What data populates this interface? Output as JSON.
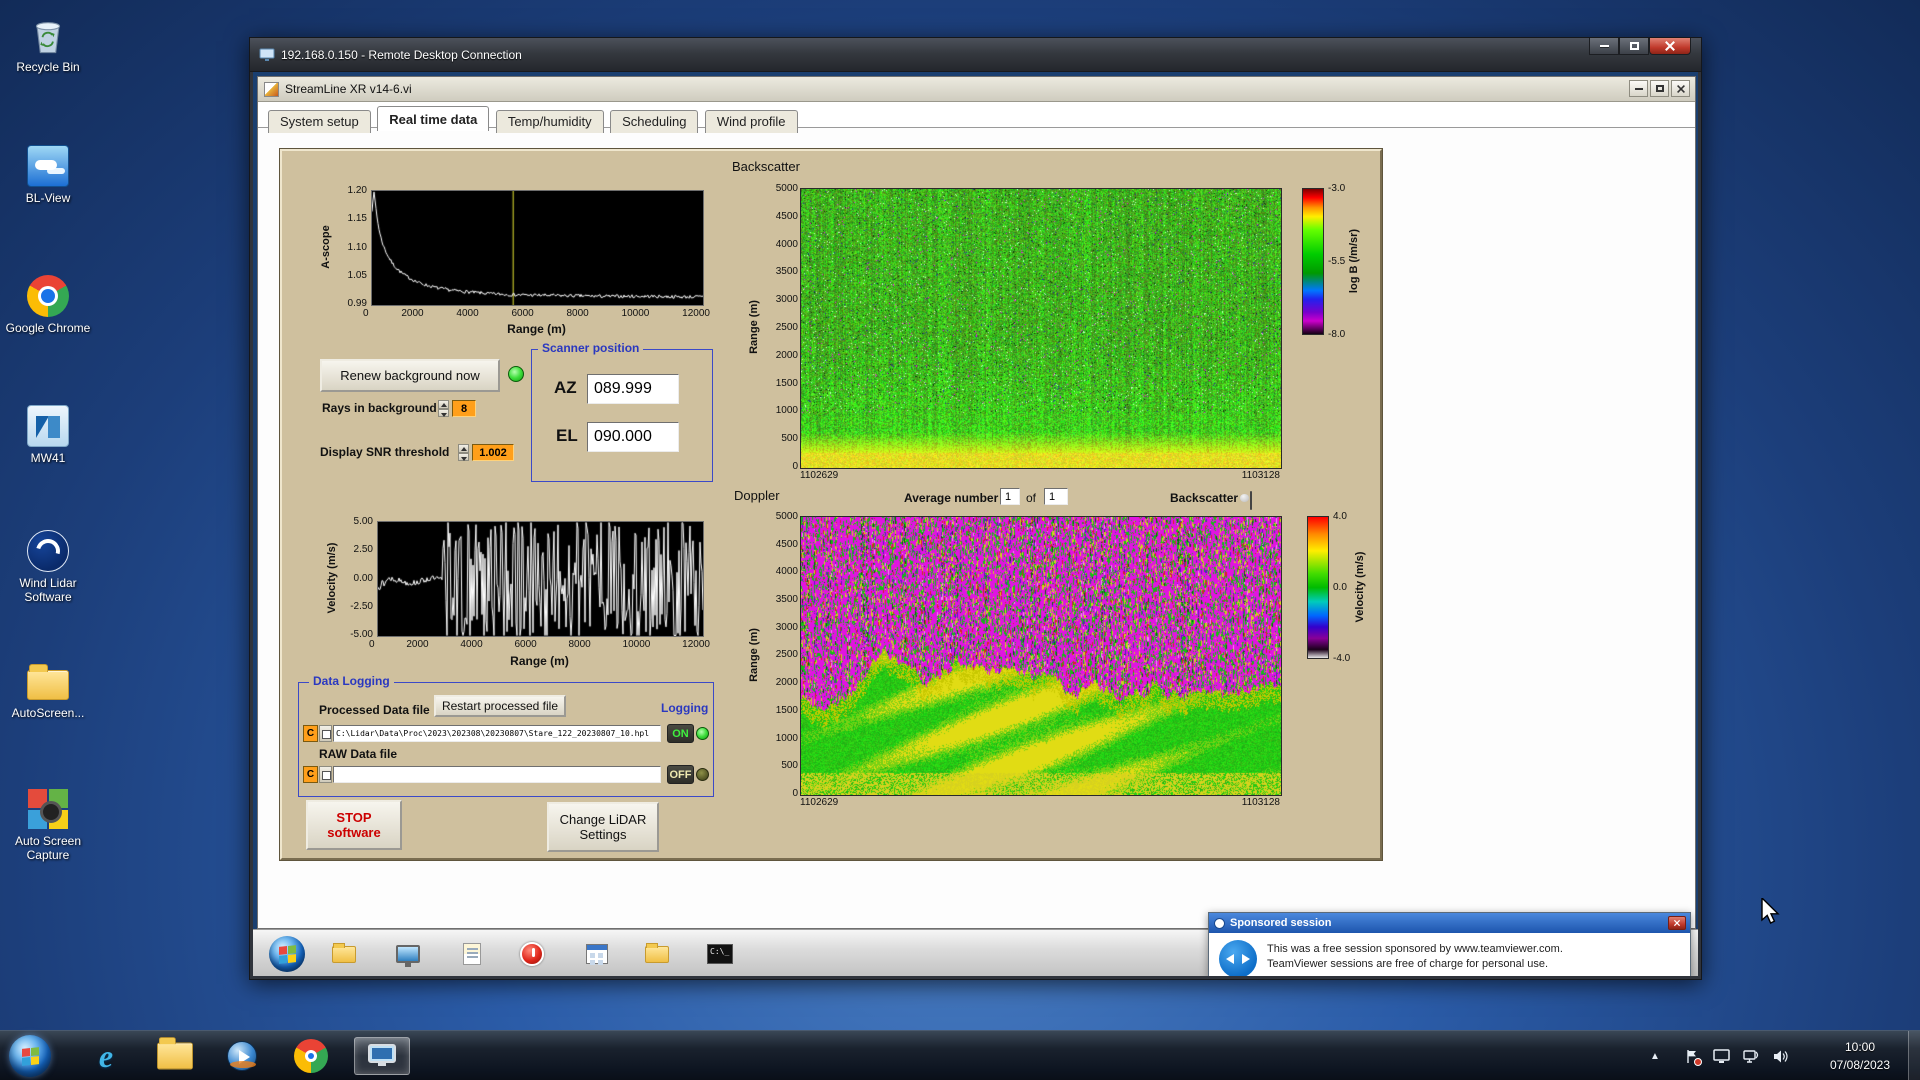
{
  "desktop": {
    "icons": [
      {
        "name": "recycle-bin",
        "label": "Recycle Bin"
      },
      {
        "name": "bl-view",
        "label": "BL-View"
      },
      {
        "name": "google-chrome",
        "label": "Google Chrome"
      },
      {
        "name": "mw41",
        "label": "MW41"
      },
      {
        "name": "wind-lidar-software",
        "label": "Wind Lidar Software"
      },
      {
        "name": "autoscreen",
        "label": "AutoScreen..."
      },
      {
        "name": "auto-screen-capture",
        "label": "Auto Screen Capture"
      }
    ]
  },
  "rdp": {
    "title": "192.168.0.150 - Remote Desktop Connection"
  },
  "labview": {
    "title": "StreamLine XR v14-6.vi",
    "tabs": [
      "System setup",
      "Real time data",
      "Temp/humidity",
      "Scheduling",
      "Wind profile"
    ],
    "active_tab": "Real time data"
  },
  "panel": {
    "backscatter_title": "Backscatter",
    "doppler_title": "Doppler",
    "renew_button": "Renew background now",
    "rays_label": "Rays in background",
    "rays_value": "8",
    "snr_label": "Display SNR threshold",
    "snr_value": "1.002",
    "scanner": {
      "legend": "Scanner position",
      "az_label": "AZ",
      "az_value": "089.999",
      "el_label": "EL",
      "el_value": "090.000"
    },
    "doppler_controls": {
      "average_label": "Average number",
      "average_value": "1",
      "of_label": "of",
      "count_value": "1",
      "backscatter_label": "Backscatter"
    },
    "logging": {
      "legend": "Data Logging",
      "processed_label": "Processed Data file",
      "restart_button": "Restart processed file",
      "logging_label": "Logging",
      "drive": "C",
      "processed_path": "C:\\Lidar\\Data\\Proc\\2023\\202308\\20230807\\Stare_122_20230807_10.hpl",
      "on_label": "ON",
      "raw_label": "RAW Data file",
      "raw_path": "",
      "off_label": "OFF"
    },
    "stop_button": [
      "STOP",
      "software"
    ],
    "change_button": [
      "Change LiDAR",
      "Settings"
    ]
  },
  "chart_data": [
    {
      "type": "line",
      "name": "A-scope",
      "ylabel": "A-scope",
      "xlabel": "Range (m)",
      "ylim": [
        0.99,
        1.2
      ],
      "xlim": [
        0,
        12000
      ],
      "yticks": [
        "1.20",
        "1.15",
        "1.10",
        "1.05",
        "0.99"
      ],
      "xticks": [
        "0",
        "2000",
        "4000",
        "6000",
        "8000",
        "10000",
        "12000"
      ],
      "cursor_x": 5100,
      "x": [
        0,
        60,
        120,
        200,
        300,
        420,
        560,
        720,
        900,
        1100,
        1350,
        1650,
        2000,
        2400,
        2900,
        3500,
        4200,
        5000,
        6000,
        7200,
        8500,
        10000,
        11200,
        12000
      ],
      "values": [
        1.165,
        1.2,
        1.178,
        1.145,
        1.118,
        1.098,
        1.082,
        1.068,
        1.057,
        1.048,
        1.04,
        1.032,
        1.026,
        1.021,
        1.017,
        1.014,
        1.011,
        1.009,
        1.008,
        1.007,
        1.006,
        1.006,
        1.005,
        1.005
      ]
    },
    {
      "type": "heatmap",
      "name": "Backscatter",
      "title": "Backscatter",
      "ylabel": "Range (m)",
      "yticks": [
        "5000",
        "4500",
        "4000",
        "3500",
        "3000",
        "2500",
        "2000",
        "1500",
        "1000",
        "500",
        "0"
      ],
      "x_labels": [
        "1102629",
        "1103128"
      ],
      "colorbar": {
        "label": "log B (/m/sr)",
        "ticks": [
          "-3.0",
          "-5.5",
          "-8.0"
        ]
      },
      "description": "noisy green backscatter field with bright yellow high-backscatter band near the ground"
    },
    {
      "type": "line",
      "name": "Velocity",
      "ylabel": "Velocity (m/s)",
      "xlabel": "Range (m)",
      "ylim": [
        -5,
        5
      ],
      "xlim": [
        0,
        12000
      ],
      "yticks": [
        "5.00",
        "2.50",
        "0.00",
        "-2.50",
        "-5.00"
      ],
      "xticks": [
        "0",
        "2000",
        "4000",
        "6000",
        "8000",
        "10000",
        "12000"
      ],
      "signal_end_x": 2400
    },
    {
      "type": "heatmap",
      "name": "Doppler",
      "title": "Doppler",
      "ylabel": "Range (m)",
      "yticks": [
        "5000",
        "4500",
        "4000",
        "3500",
        "3000",
        "2500",
        "2000",
        "1500",
        "1000",
        "500",
        "0"
      ],
      "x_labels": [
        "1102629",
        "1103128"
      ],
      "colorbar": {
        "label": "Velocity (m/s)",
        "ticks": [
          "4.0",
          "0.0",
          "-4.0"
        ]
      },
      "description": "green/yellow aerosol layer below ~2000 m, magenta-green noise speckle above"
    }
  ],
  "remote_taskbar": {
    "icons": [
      "explorer-icon",
      "display-icon",
      "document-icon",
      "power-icon",
      "app-window-icon",
      "folder-icon",
      "cmd-icon"
    ],
    "cmd_text": "C:\\_"
  },
  "teamviewer": {
    "title": "Sponsored session",
    "line1": "This was a free session sponsored by www.teamviewer.com.",
    "line2": "TeamViewer sessions are free of charge for personal use."
  },
  "taskbar": {
    "icons": [
      "start-orb",
      "internet-explorer-icon",
      "explorer-icon",
      "media-player-icon",
      "chrome-icon",
      "rdp-icon"
    ]
  },
  "tray": {
    "time": "10:00",
    "date": "07/08/2023"
  }
}
